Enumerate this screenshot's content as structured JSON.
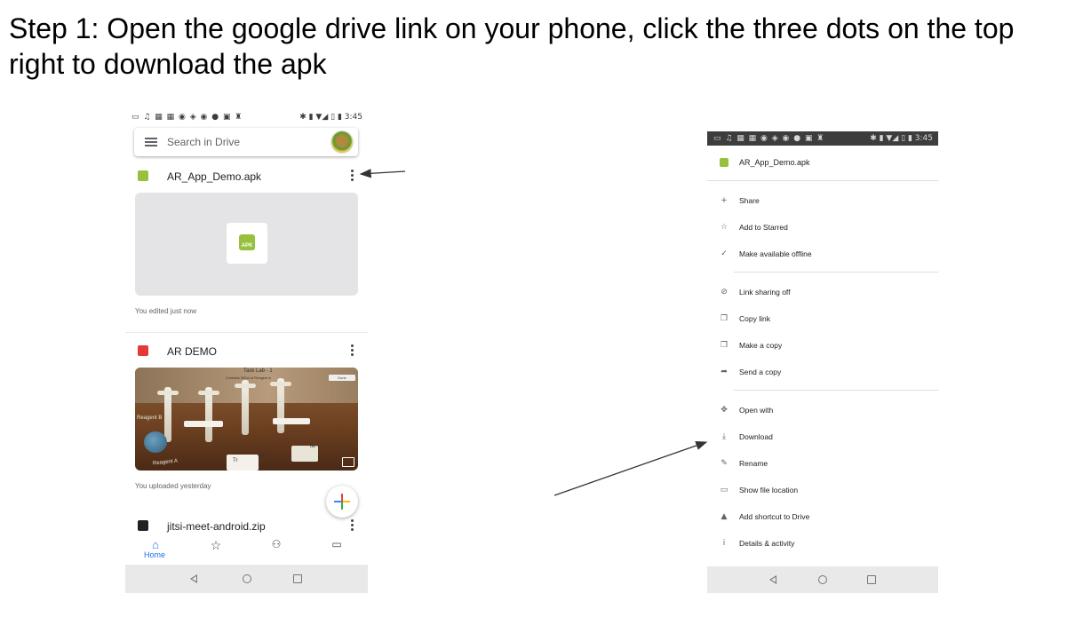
{
  "heading": "Step 1: Open the google drive link on your phone, click the three dots on the top right to download the apk",
  "left_phone": {
    "status_time": "3:45",
    "search_placeholder": "Search in Drive",
    "files": [
      {
        "name": "AR_App_Demo.apk",
        "meta": "You edited just now",
        "icon": "apk-icon",
        "color": "#97c03d"
      },
      {
        "name": "AR DEMO",
        "meta": "You uploaded yesterday",
        "icon": "video-icon",
        "color": "#e53935"
      },
      {
        "name": "jitsi-meet-android.zip",
        "icon": "zip-icon",
        "color": "#202124"
      }
    ],
    "apk_badge": "APK",
    "video_overlay": {
      "top_label_1": "Task Lab - 1",
      "top_label_2": "Contains 300ul of Reagent A",
      "done": "Done",
      "reagent_b": "Reagent B",
      "reagent_a": "Reagent A",
      "tr": "Tr",
      "sal": "sal",
      "ter": "ter"
    },
    "bottom_nav": {
      "home": "Home"
    },
    "accent": "#1a73e8"
  },
  "right_phone": {
    "status_time": "3:45",
    "file_name": "AR_App_Demo.apk",
    "menu_groups": [
      [
        {
          "label": "Share",
          "icon": "add-person-icon",
          "glyph": "+"
        },
        {
          "label": "Add to Starred",
          "icon": "star-icon",
          "glyph": "☆"
        },
        {
          "label": "Make available offline",
          "icon": "offline-icon",
          "glyph": "✓"
        }
      ],
      [
        {
          "label": "Link sharing off",
          "icon": "link-off-icon",
          "glyph": "⊘"
        },
        {
          "label": "Copy link",
          "icon": "copy-icon",
          "glyph": "❐"
        },
        {
          "label": "Make a copy",
          "icon": "file-copy-icon",
          "glyph": "❐"
        },
        {
          "label": "Send a copy",
          "icon": "send-icon",
          "glyph": "➦"
        }
      ],
      [
        {
          "label": "Open with",
          "icon": "open-with-icon",
          "glyph": "✥"
        },
        {
          "label": "Download",
          "icon": "download-icon",
          "glyph": "⤓"
        },
        {
          "label": "Rename",
          "icon": "rename-icon",
          "glyph": "✎"
        },
        {
          "label": "Show file location",
          "icon": "folder-icon",
          "glyph": "▭"
        },
        {
          "label": "Add shortcut to Drive",
          "icon": "drive-shortcut-icon",
          "glyph": "▲"
        },
        {
          "label": "Details & activity",
          "icon": "info-icon",
          "glyph": "i"
        }
      ]
    ]
  }
}
